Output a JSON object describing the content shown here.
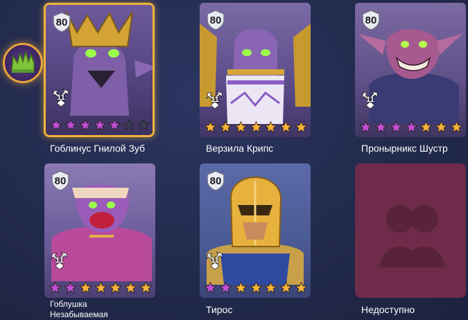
{
  "heroes": [
    {
      "name": "Гоблинус Гнилой Зуб",
      "level": "80",
      "element_level": "11",
      "stars": [
        "purple",
        "purple",
        "purple",
        "purple",
        "purple",
        "gray",
        "gray"
      ],
      "selected": true
    },
    {
      "name": "Верзила Крипс",
      "level": "80",
      "element_level": "11",
      "stars": [
        "gold",
        "gold",
        "gold",
        "gold",
        "gold",
        "gold",
        "gold"
      ],
      "selected": false
    },
    {
      "name": "Пронырникс Шустр",
      "level": "80",
      "element_level": "11",
      "stars": [
        "purple",
        "purple",
        "purple",
        "purple",
        "gold",
        "gold",
        "gold"
      ],
      "selected": false
    },
    {
      "name_line1": "Гоблушка",
      "name_line2": "Незабываемая",
      "level": "80",
      "element_level": "11",
      "stars": [
        "purple",
        "purple",
        "gold",
        "gold",
        "gold",
        "gold",
        "gold"
      ],
      "selected": false
    },
    {
      "name": "Тирос",
      "level": "80",
      "element_level": "11",
      "stars": [
        "purple",
        "purple",
        "gold",
        "gold",
        "gold",
        "gold",
        "gold"
      ],
      "selected": false
    }
  ],
  "unavailable_label": "Недоступно",
  "colors": {
    "background": "#252d50",
    "selected_border": "#f0b23a",
    "star_gold": "#f5b43a",
    "star_purple": "#c24fd8",
    "star_gray": "#3a3f58",
    "unavailable_bg": "#6e2c4a"
  },
  "icons": {
    "bonus": "crown-bonus-icon",
    "level": "level-badge-icon",
    "element": "element-arrows-icon",
    "star": "star-icon"
  }
}
